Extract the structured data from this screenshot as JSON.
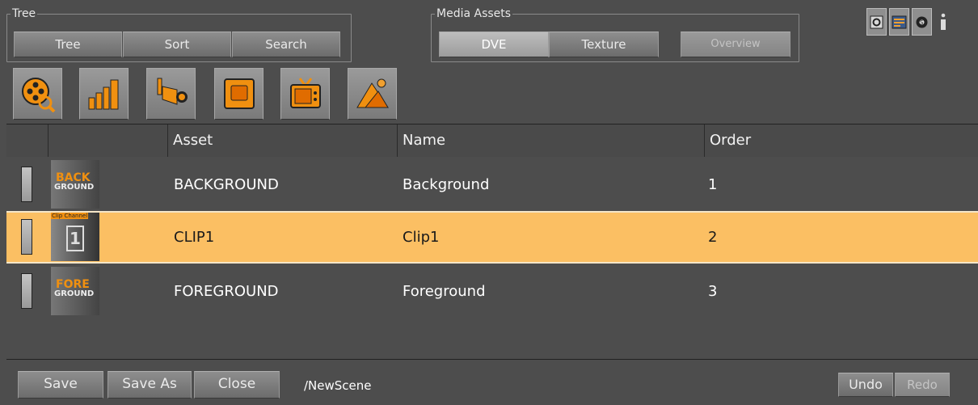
{
  "tree_group": {
    "title": "Tree",
    "buttons": [
      "Tree",
      "Sort",
      "Search"
    ]
  },
  "media_group": {
    "title": "Media Assets",
    "buttons": [
      "DVE",
      "Texture",
      "Overview"
    ],
    "active": "DVE",
    "disabled": "Overview"
  },
  "top_icons": [
    "settings-icon",
    "layout-icon",
    "script-icon",
    "info-icon"
  ],
  "asset_icons": [
    "film-reel-icon",
    "bar-chart-icon",
    "spotlight-icon",
    "frame-icon",
    "tv-icon",
    "image-icon"
  ],
  "table": {
    "columns": [
      "",
      "",
      "Asset",
      "Name",
      "Order"
    ],
    "rows": [
      {
        "thumb_label_top": "BACK",
        "thumb_label_bottom": "GROUND",
        "asset": "BACKGROUND",
        "name": "Background",
        "order": "1",
        "selected": false
      },
      {
        "thumb_label_top": "Clip Channel",
        "thumb_label_bottom": "1",
        "asset": "CLIP1",
        "name": "Clip1",
        "order": "2",
        "selected": true
      },
      {
        "thumb_label_top": "FORE",
        "thumb_label_bottom": "GROUND",
        "asset": "FOREGROUND",
        "name": "Foreground",
        "order": "3",
        "selected": false
      }
    ]
  },
  "footer": {
    "save": "Save",
    "save_as": "Save As",
    "close": "Close",
    "path": "/NewScene",
    "undo": "Undo",
    "redo": "Redo"
  },
  "colors": {
    "background": "#4d4d4d",
    "selected_row": "#fbbf63",
    "accent_orange": "#f09010"
  }
}
